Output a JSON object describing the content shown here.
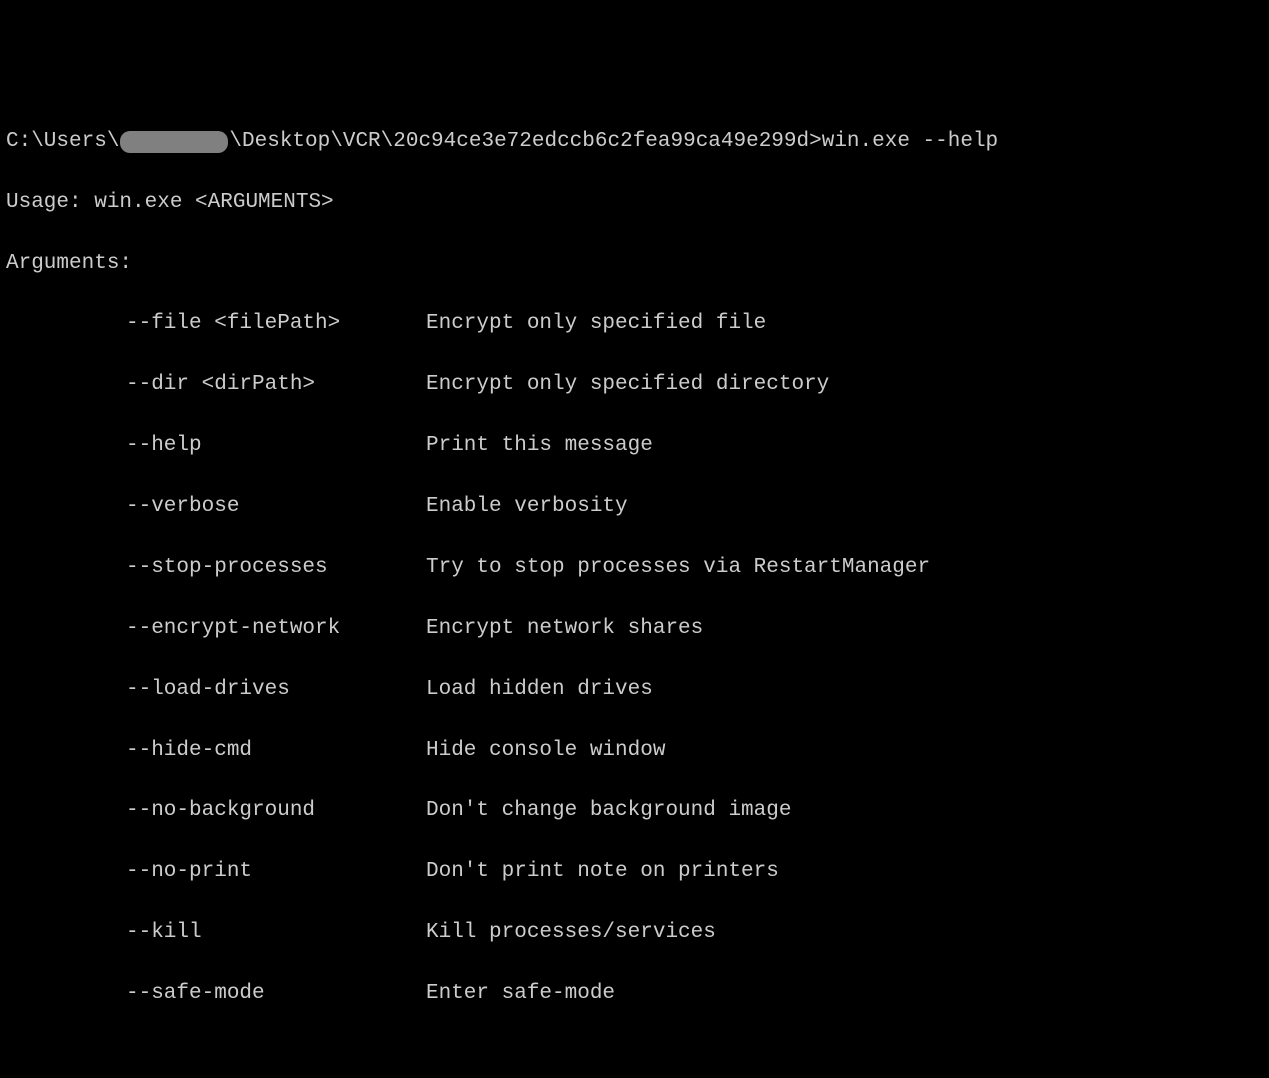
{
  "prompt": {
    "path_prefix": "C:\\Users\\",
    "path_suffix": "\\Desktop\\VCR\\20c94ce3e72edccb6c2fea99ca49e299d>",
    "command": "win.exe --help"
  },
  "usage_line": "Usage: win.exe <ARGUMENTS>",
  "arguments_header": "Arguments:",
  "arguments": [
    {
      "flag": "--file <filePath>",
      "desc": "Encrypt only specified file"
    },
    {
      "flag": "--dir <dirPath>",
      "desc": "Encrypt only specified directory"
    },
    {
      "flag": "--help",
      "desc": "Print this message"
    },
    {
      "flag": "--verbose",
      "desc": "Enable verbosity"
    },
    {
      "flag": "--stop-processes",
      "desc": "Try to stop processes via RestartManager"
    },
    {
      "flag": "--encrypt-network",
      "desc": "Encrypt network shares"
    },
    {
      "flag": "--load-drives",
      "desc": "Load hidden drives"
    },
    {
      "flag": "--hide-cmd",
      "desc": "Hide console window"
    },
    {
      "flag": "--no-background",
      "desc": "Don't change background image"
    },
    {
      "flag": "--no-print",
      "desc": "Don't print note on printers"
    },
    {
      "flag": "--kill",
      "desc": "Kill processes/services"
    },
    {
      "flag": "--safe-mode",
      "desc": "Enter safe-mode"
    }
  ]
}
